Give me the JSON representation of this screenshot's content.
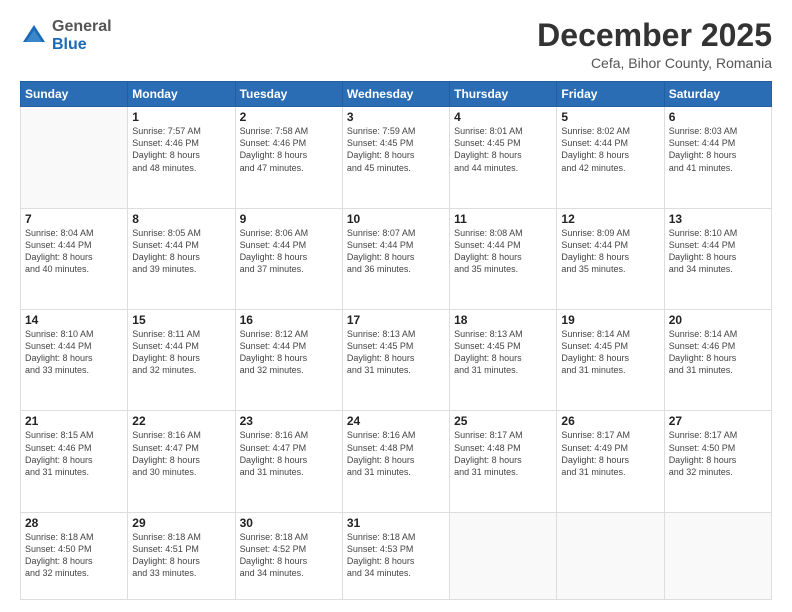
{
  "logo": {
    "general": "General",
    "blue": "Blue"
  },
  "header": {
    "month_title": "December 2025",
    "location": "Cefa, Bihor County, Romania"
  },
  "days_of_week": [
    "Sunday",
    "Monday",
    "Tuesday",
    "Wednesday",
    "Thursday",
    "Friday",
    "Saturday"
  ],
  "weeks": [
    [
      {
        "day": "",
        "info": ""
      },
      {
        "day": "1",
        "info": "Sunrise: 7:57 AM\nSunset: 4:46 PM\nDaylight: 8 hours\nand 48 minutes."
      },
      {
        "day": "2",
        "info": "Sunrise: 7:58 AM\nSunset: 4:46 PM\nDaylight: 8 hours\nand 47 minutes."
      },
      {
        "day": "3",
        "info": "Sunrise: 7:59 AM\nSunset: 4:45 PM\nDaylight: 8 hours\nand 45 minutes."
      },
      {
        "day": "4",
        "info": "Sunrise: 8:01 AM\nSunset: 4:45 PM\nDaylight: 8 hours\nand 44 minutes."
      },
      {
        "day": "5",
        "info": "Sunrise: 8:02 AM\nSunset: 4:44 PM\nDaylight: 8 hours\nand 42 minutes."
      },
      {
        "day": "6",
        "info": "Sunrise: 8:03 AM\nSunset: 4:44 PM\nDaylight: 8 hours\nand 41 minutes."
      }
    ],
    [
      {
        "day": "7",
        "info": "Sunrise: 8:04 AM\nSunset: 4:44 PM\nDaylight: 8 hours\nand 40 minutes."
      },
      {
        "day": "8",
        "info": "Sunrise: 8:05 AM\nSunset: 4:44 PM\nDaylight: 8 hours\nand 39 minutes."
      },
      {
        "day": "9",
        "info": "Sunrise: 8:06 AM\nSunset: 4:44 PM\nDaylight: 8 hours\nand 37 minutes."
      },
      {
        "day": "10",
        "info": "Sunrise: 8:07 AM\nSunset: 4:44 PM\nDaylight: 8 hours\nand 36 minutes."
      },
      {
        "day": "11",
        "info": "Sunrise: 8:08 AM\nSunset: 4:44 PM\nDaylight: 8 hours\nand 35 minutes."
      },
      {
        "day": "12",
        "info": "Sunrise: 8:09 AM\nSunset: 4:44 PM\nDaylight: 8 hours\nand 35 minutes."
      },
      {
        "day": "13",
        "info": "Sunrise: 8:10 AM\nSunset: 4:44 PM\nDaylight: 8 hours\nand 34 minutes."
      }
    ],
    [
      {
        "day": "14",
        "info": "Sunrise: 8:10 AM\nSunset: 4:44 PM\nDaylight: 8 hours\nand 33 minutes."
      },
      {
        "day": "15",
        "info": "Sunrise: 8:11 AM\nSunset: 4:44 PM\nDaylight: 8 hours\nand 32 minutes."
      },
      {
        "day": "16",
        "info": "Sunrise: 8:12 AM\nSunset: 4:44 PM\nDaylight: 8 hours\nand 32 minutes."
      },
      {
        "day": "17",
        "info": "Sunrise: 8:13 AM\nSunset: 4:45 PM\nDaylight: 8 hours\nand 31 minutes."
      },
      {
        "day": "18",
        "info": "Sunrise: 8:13 AM\nSunset: 4:45 PM\nDaylight: 8 hours\nand 31 minutes."
      },
      {
        "day": "19",
        "info": "Sunrise: 8:14 AM\nSunset: 4:45 PM\nDaylight: 8 hours\nand 31 minutes."
      },
      {
        "day": "20",
        "info": "Sunrise: 8:14 AM\nSunset: 4:46 PM\nDaylight: 8 hours\nand 31 minutes."
      }
    ],
    [
      {
        "day": "21",
        "info": "Sunrise: 8:15 AM\nSunset: 4:46 PM\nDaylight: 8 hours\nand 31 minutes."
      },
      {
        "day": "22",
        "info": "Sunrise: 8:16 AM\nSunset: 4:47 PM\nDaylight: 8 hours\nand 30 minutes."
      },
      {
        "day": "23",
        "info": "Sunrise: 8:16 AM\nSunset: 4:47 PM\nDaylight: 8 hours\nand 31 minutes."
      },
      {
        "day": "24",
        "info": "Sunrise: 8:16 AM\nSunset: 4:48 PM\nDaylight: 8 hours\nand 31 minutes."
      },
      {
        "day": "25",
        "info": "Sunrise: 8:17 AM\nSunset: 4:48 PM\nDaylight: 8 hours\nand 31 minutes."
      },
      {
        "day": "26",
        "info": "Sunrise: 8:17 AM\nSunset: 4:49 PM\nDaylight: 8 hours\nand 31 minutes."
      },
      {
        "day": "27",
        "info": "Sunrise: 8:17 AM\nSunset: 4:50 PM\nDaylight: 8 hours\nand 32 minutes."
      }
    ],
    [
      {
        "day": "28",
        "info": "Sunrise: 8:18 AM\nSunset: 4:50 PM\nDaylight: 8 hours\nand 32 minutes."
      },
      {
        "day": "29",
        "info": "Sunrise: 8:18 AM\nSunset: 4:51 PM\nDaylight: 8 hours\nand 33 minutes."
      },
      {
        "day": "30",
        "info": "Sunrise: 8:18 AM\nSunset: 4:52 PM\nDaylight: 8 hours\nand 34 minutes."
      },
      {
        "day": "31",
        "info": "Sunrise: 8:18 AM\nSunset: 4:53 PM\nDaylight: 8 hours\nand 34 minutes."
      },
      {
        "day": "",
        "info": ""
      },
      {
        "day": "",
        "info": ""
      },
      {
        "day": "",
        "info": ""
      }
    ]
  ]
}
